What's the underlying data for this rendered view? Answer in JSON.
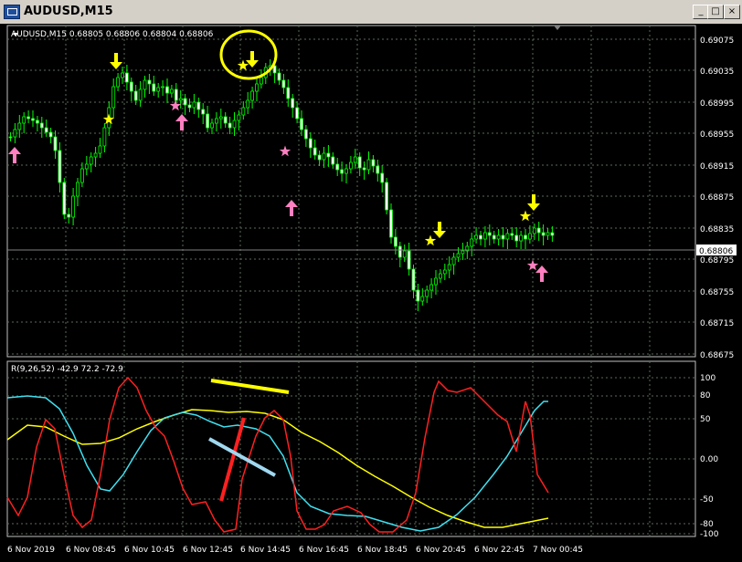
{
  "window": {
    "title": "AUDUSD,M15",
    "min_label": "_",
    "max_label": "□",
    "close_label": "×"
  },
  "main_chart": {
    "header": "AUDUSD,M15  0.68805 0.68806 0.68804 0.68806",
    "price_axis": [
      "0.69075",
      "0.69035",
      "0.68995",
      "0.68955",
      "0.68915",
      "0.68875",
      "0.68835",
      "0.68795",
      "0.68755",
      "0.68715",
      "0.68675"
    ],
    "current_price": "0.68806",
    "colors": {
      "up_candle": "#00ff00",
      "down_candle": "#ffffff",
      "grid": "#5a6a5a",
      "current_price_line": "#808080"
    }
  },
  "indicator": {
    "header": "R(9,26,52) -42.9 72.2 -72.9",
    "levels": [
      "100",
      "80",
      "50",
      "0.00",
      "-50",
      "-80",
      "-100"
    ],
    "colors": {
      "fast": "#ff2020",
      "medium": "#40e0f0",
      "slow": "#ffff00"
    }
  },
  "time_axis": [
    "6 Nov 2019",
    "6 Nov 08:45",
    "6 Nov 10:45",
    "6 Nov 12:45",
    "6 Nov 14:45",
    "6 Nov 16:45",
    "6 Nov 18:45",
    "6 Nov 20:45",
    "6 Nov 22:45",
    "7 Nov 00:45"
  ],
  "annotations": {
    "down_arrow_color": "#ffff00",
    "up_arrow_color": "#ff80c0",
    "star_yellow": "#ffff00",
    "star_pink": "#ff80c0",
    "divergence_line_yellow": "#ffff00",
    "divergence_line_red": "#ff2020",
    "divergence_line_blue": "#a0d8f0"
  }
}
